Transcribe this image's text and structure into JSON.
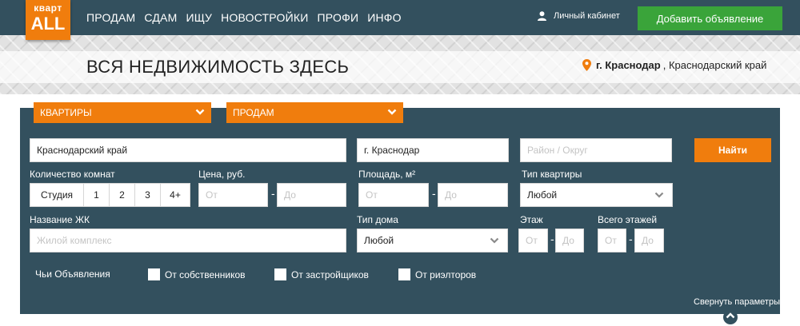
{
  "logo": {
    "line1": "кварт",
    "line2": "ALL"
  },
  "nav": [
    "ПРОДАМ",
    "СДАМ",
    "ИЩУ",
    "НОВОСТРОЙКИ",
    "ПРОФИ",
    "ИНФО"
  ],
  "header": {
    "cabinet_label": "Личный кабинет",
    "add_button": "Добавить объявление"
  },
  "banner": {
    "slogan": "ВСЯ НЕДВИЖИМОСТЬ ЗДЕСЬ",
    "city": "г. Краснодар",
    "region": ", Краснодарский край"
  },
  "tabs": {
    "property_type": "КВАРТИРЫ",
    "deal_type": "ПРОДАМ"
  },
  "filters": {
    "region_value": "Краснодарский край",
    "city_value": "г. Краснодар",
    "district_placeholder": "Район / Округ",
    "search_button": "Найти",
    "rooms_label": "Количество комнат",
    "rooms": [
      "Студия",
      "1",
      "2",
      "3",
      "4+"
    ],
    "price_label": "Цена, руб.",
    "area_label": "Площадь, м²",
    "apartment_type_label": "Тип квартиры",
    "apartment_type_value": "Любой",
    "from_placeholder": "От",
    "to_placeholder": "До",
    "dash": "-",
    "complex_label": "Название ЖК",
    "complex_placeholder": "Жилой комплекс",
    "house_type_label": "Тип дома",
    "house_type_value": "Любой",
    "floor_label": "Этаж",
    "total_floors_label": "Всего этажей",
    "owners_label": "Чьи Объявления",
    "owner_options": [
      "От собственников",
      "От застройщиков",
      "От риэлторов"
    ],
    "collapse_label": "Свернуть параметры"
  },
  "colors": {
    "header_bg": "#33505e",
    "accent_orange": "#f07d0d",
    "green_button": "#3aa43a"
  },
  "icons": {
    "user": "user-icon",
    "location": "location-pin-icon",
    "chevron": "chevron-down-icon",
    "collapse": "chevron-up-icon"
  }
}
